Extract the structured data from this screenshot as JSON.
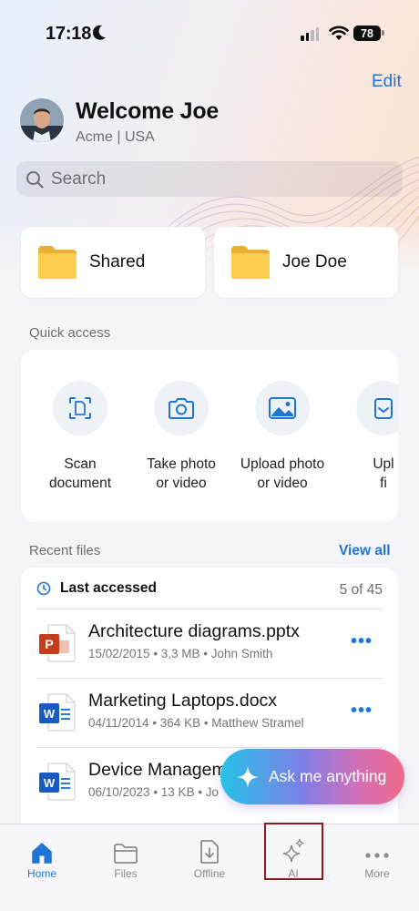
{
  "status_bar": {
    "time": "17:18",
    "battery": "78"
  },
  "header": {
    "edit_label": "Edit",
    "welcome": "Welcome Joe",
    "org": "Acme | USA"
  },
  "search": {
    "placeholder": "Search"
  },
  "folders": [
    {
      "label": "Shared",
      "icon": "folder-icon"
    },
    {
      "label": "Joe Doe",
      "icon": "folder-icon"
    }
  ],
  "quick_access": {
    "title": "Quick access",
    "items": [
      {
        "label": "Scan\ndocument",
        "icon": "scan-document-icon"
      },
      {
        "label": "Take photo\nor video",
        "icon": "camera-icon"
      },
      {
        "label": "Upload photo\nor video",
        "icon": "image-icon"
      },
      {
        "label": "Upl\nfi",
        "icon": "upload-file-icon"
      }
    ]
  },
  "recent_files": {
    "title": "Recent files",
    "view_all": "View all",
    "group_label": "Last accessed",
    "count": "5 of 45",
    "files": [
      {
        "name": "Architecture diagrams.pptx",
        "meta": "15/02/2015 • 3,3 MB • John Smith",
        "type": "powerpoint"
      },
      {
        "name": "Marketing Laptops.docx",
        "meta": "04/11/2014 • 364 KB • Matthew Stramel",
        "type": "word"
      },
      {
        "name": "Device Managem",
        "meta": "06/10/2023 • 13 KB • Jo",
        "type": "word"
      }
    ],
    "more_label": "•••"
  },
  "ask_button": {
    "label": "Ask me anything"
  },
  "tabbar": {
    "tabs": [
      {
        "label": "Home",
        "active": true
      },
      {
        "label": "Files",
        "active": false
      },
      {
        "label": "Offline",
        "active": false
      },
      {
        "label": "AI",
        "active": false
      },
      {
        "label": "More",
        "active": false
      }
    ]
  },
  "colors": {
    "accent": "#1f74d6",
    "folder": "#f7c948",
    "highlight_box": "#8e1c1c"
  }
}
